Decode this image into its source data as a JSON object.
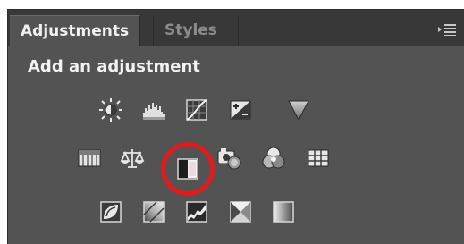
{
  "tabs": {
    "adjustments_label": "Adjustments",
    "styles_label": "Styles"
  },
  "panel_menu_icon": "panel-menu-icon",
  "heading": "Add an adjustment",
  "highlight_color": "#e11b1b",
  "icons": {
    "row1": [
      "brightness-contrast-icon",
      "levels-icon",
      "curves-icon",
      "exposure-icon",
      "vibrance-icon"
    ],
    "row2": [
      "hue-saturation-icon",
      "color-balance-icon",
      "black-white-icon",
      "photo-filter-icon",
      "channel-mixer-icon",
      "color-lookup-icon"
    ],
    "row3": [
      "invert-icon",
      "posterize-icon",
      "threshold-icon",
      "selective-color-icon",
      "gradient-map-icon"
    ]
  },
  "highlighted_icon": "black-white-icon"
}
